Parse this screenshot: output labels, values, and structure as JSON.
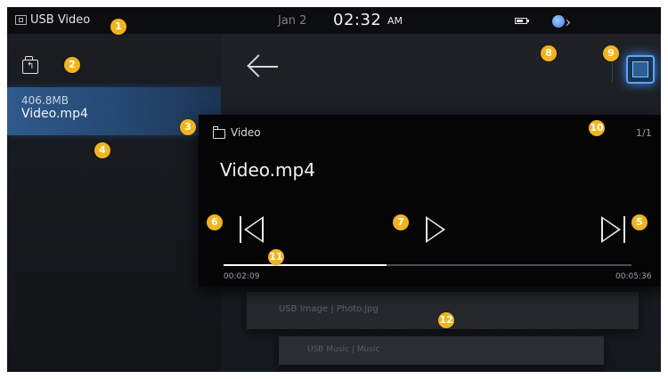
{
  "status_bar": {
    "source_label": "USB Video",
    "date": "Jan 2",
    "time": "02:32",
    "ampm": "AM",
    "source_icon": "usb-video-icon",
    "battery_icon": "battery-icon",
    "network_icon": "network-globe-icon"
  },
  "left_panel": {
    "upfolder_icon": "folder-up-icon",
    "items": [
      {
        "size": "406.8MB",
        "name": "Video.mp4"
      }
    ]
  },
  "toolbar": {
    "back_icon": "back-arrow-icon",
    "screen_icon": "screen-view-icon"
  },
  "player": {
    "folder_icon": "folder-icon",
    "folder_label": "Video",
    "page_count": "1/1",
    "title": "Video.mp4",
    "prev_icon": "skip-previous-icon",
    "play_icon": "play-icon",
    "next_icon": "skip-next-icon",
    "elapsed": "00:02:09",
    "duration": "00:05:36",
    "progress_fraction": 0.4
  },
  "background_cards": [
    {
      "label": "USB Image | Photo.jpg"
    },
    {
      "label": "USB Music | Music"
    }
  ],
  "callouts": [
    "1",
    "2",
    "3",
    "4",
    "5",
    "6",
    "7",
    "8",
    "9",
    "10",
    "11",
    "12"
  ],
  "colors": {
    "accent_blue": "#3d8fff",
    "callout_yellow": "#f2b41a",
    "selected_item": "#2f5a8c"
  }
}
